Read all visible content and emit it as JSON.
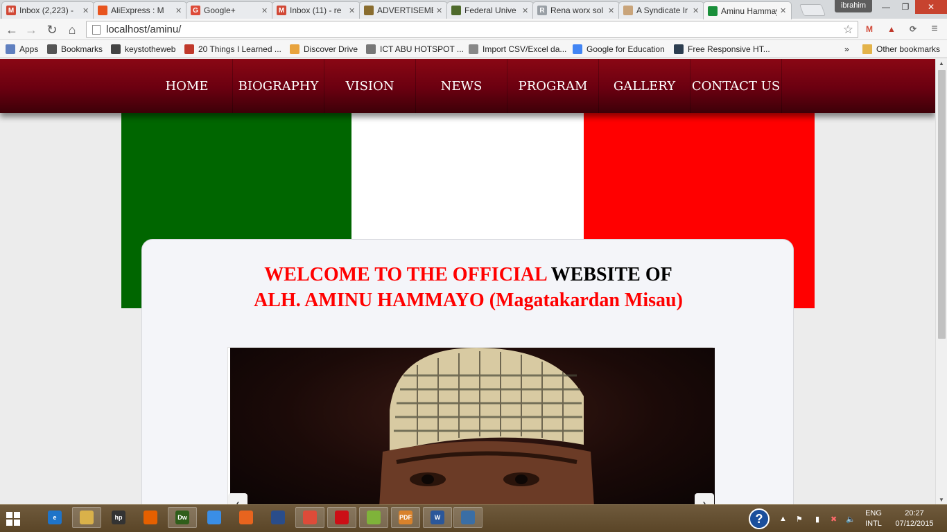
{
  "browser": {
    "tabs": [
      {
        "title": "Inbox (2,223) -",
        "icon": "gmail-icon",
        "color": "#d14836",
        "glyph": "M",
        "active": false
      },
      {
        "title": "AliExpress : M",
        "icon": "aliexpress-icon",
        "color": "#e8541e",
        "glyph": "",
        "active": false
      },
      {
        "title": "Google+",
        "icon": "google-plus-icon",
        "color": "#dd4b39",
        "glyph": "G",
        "active": false
      },
      {
        "title": "Inbox (11) - re",
        "icon": "gmail-icon",
        "color": "#d14836",
        "glyph": "M",
        "active": false
      },
      {
        "title": "ADVERTISEMEN",
        "icon": "crest-icon",
        "color": "#8a6d2f",
        "glyph": "",
        "active": false
      },
      {
        "title": "Federal Unive",
        "icon": "university-icon",
        "color": "#4f6b2c",
        "glyph": "",
        "active": false
      },
      {
        "title": "Rena worx sol",
        "icon": "rena-icon",
        "color": "#9aa0a6",
        "glyph": "R",
        "active": false
      },
      {
        "title": "A Syndicate Ir",
        "icon": "syndicate-icon",
        "color": "#c9a47a",
        "glyph": "",
        "active": false
      },
      {
        "title": "Aminu Hammay",
        "icon": "site-icon",
        "color": "#1a8f3a",
        "glyph": "",
        "active": true
      }
    ],
    "profile_name": "ibrahim",
    "url": "localhost/aminu/",
    "bookmarks": [
      {
        "label": "Apps",
        "icon": "apps-grid-icon",
        "color": "#5f7fbf"
      },
      {
        "label": "Bookmarks",
        "icon": "star-icon",
        "color": "#555555"
      },
      {
        "label": "keystotheweb",
        "icon": "keys-icon",
        "color": "#444444"
      },
      {
        "label": "20 Things I Learned ...",
        "icon": "book-icon",
        "color": "#c0392b"
      },
      {
        "label": "Discover Drive",
        "icon": "code-icon",
        "color": "#e8a33d"
      },
      {
        "label": "ICT ABU HOTSPOT ...",
        "icon": "page-icon",
        "color": "#777777"
      },
      {
        "label": "Import CSV/Excel da...",
        "icon": "r-icon",
        "color": "#888888"
      },
      {
        "label": "Google for Education",
        "icon": "google-icon",
        "color": "#4285f4"
      },
      {
        "label": "Free Responsive HT...",
        "icon": "w3-icon",
        "color": "#2d3e50"
      }
    ],
    "more_bookmarks": "»",
    "other_bookmarks": "Other bookmarks"
  },
  "site": {
    "nav": [
      "HOME",
      "BIOGRAPHY",
      "VISION",
      "NEWS",
      "PROGRAM",
      "GALLERY",
      "CONTACT US"
    ],
    "flag_colors": {
      "green": "#006600",
      "white": "#ffffff",
      "red": "#ff0000"
    },
    "welcome": {
      "line1_red": "WELCOME TO THE OFFICIAL",
      "line1_black": " WEBSITE OF",
      "line2": "ALH. AMINU HAMMAYO (Magatakardan Misau)"
    },
    "slider": {
      "prev": "‹",
      "next": "›"
    }
  },
  "taskbar": {
    "apps": [
      {
        "icon": "ie-icon",
        "color": "#1f74c9",
        "glyph": "e",
        "open": false
      },
      {
        "icon": "file-explorer-icon",
        "color": "#d9b14a",
        "glyph": "",
        "open": true
      },
      {
        "icon": "hp-icon",
        "color": "#333333",
        "glyph": "hp",
        "open": false
      },
      {
        "icon": "firefox-icon",
        "color": "#e66000",
        "glyph": "",
        "open": false
      },
      {
        "icon": "dreamweaver-icon",
        "color": "#2f5e1a",
        "glyph": "Dw",
        "open": true
      },
      {
        "icon": "safari-icon",
        "color": "#3a8ee6",
        "glyph": "",
        "open": false
      },
      {
        "icon": "sandbox-icon",
        "color": "#e8641e",
        "glyph": "",
        "open": false
      },
      {
        "icon": "media-icon",
        "color": "#2a4d8a",
        "glyph": "",
        "open": false
      },
      {
        "icon": "chrome-icon",
        "color": "#dd4b39",
        "glyph": "",
        "open": true
      },
      {
        "icon": "opera-icon",
        "color": "#cc0f16",
        "glyph": "",
        "open": true
      },
      {
        "icon": "folder-sync-icon",
        "color": "#7fb33a",
        "glyph": "",
        "open": true
      },
      {
        "icon": "pdf-icon",
        "color": "#d9822b",
        "glyph": "PDF",
        "open": true
      },
      {
        "icon": "word-icon",
        "color": "#2b579a",
        "glyph": "W",
        "open": true
      },
      {
        "icon": "window-icon",
        "color": "#3a6ea5",
        "glyph": "",
        "open": true
      }
    ],
    "language": "ENG",
    "language_sub": "INTL",
    "time": "20:27",
    "date": "07/12/2015"
  }
}
